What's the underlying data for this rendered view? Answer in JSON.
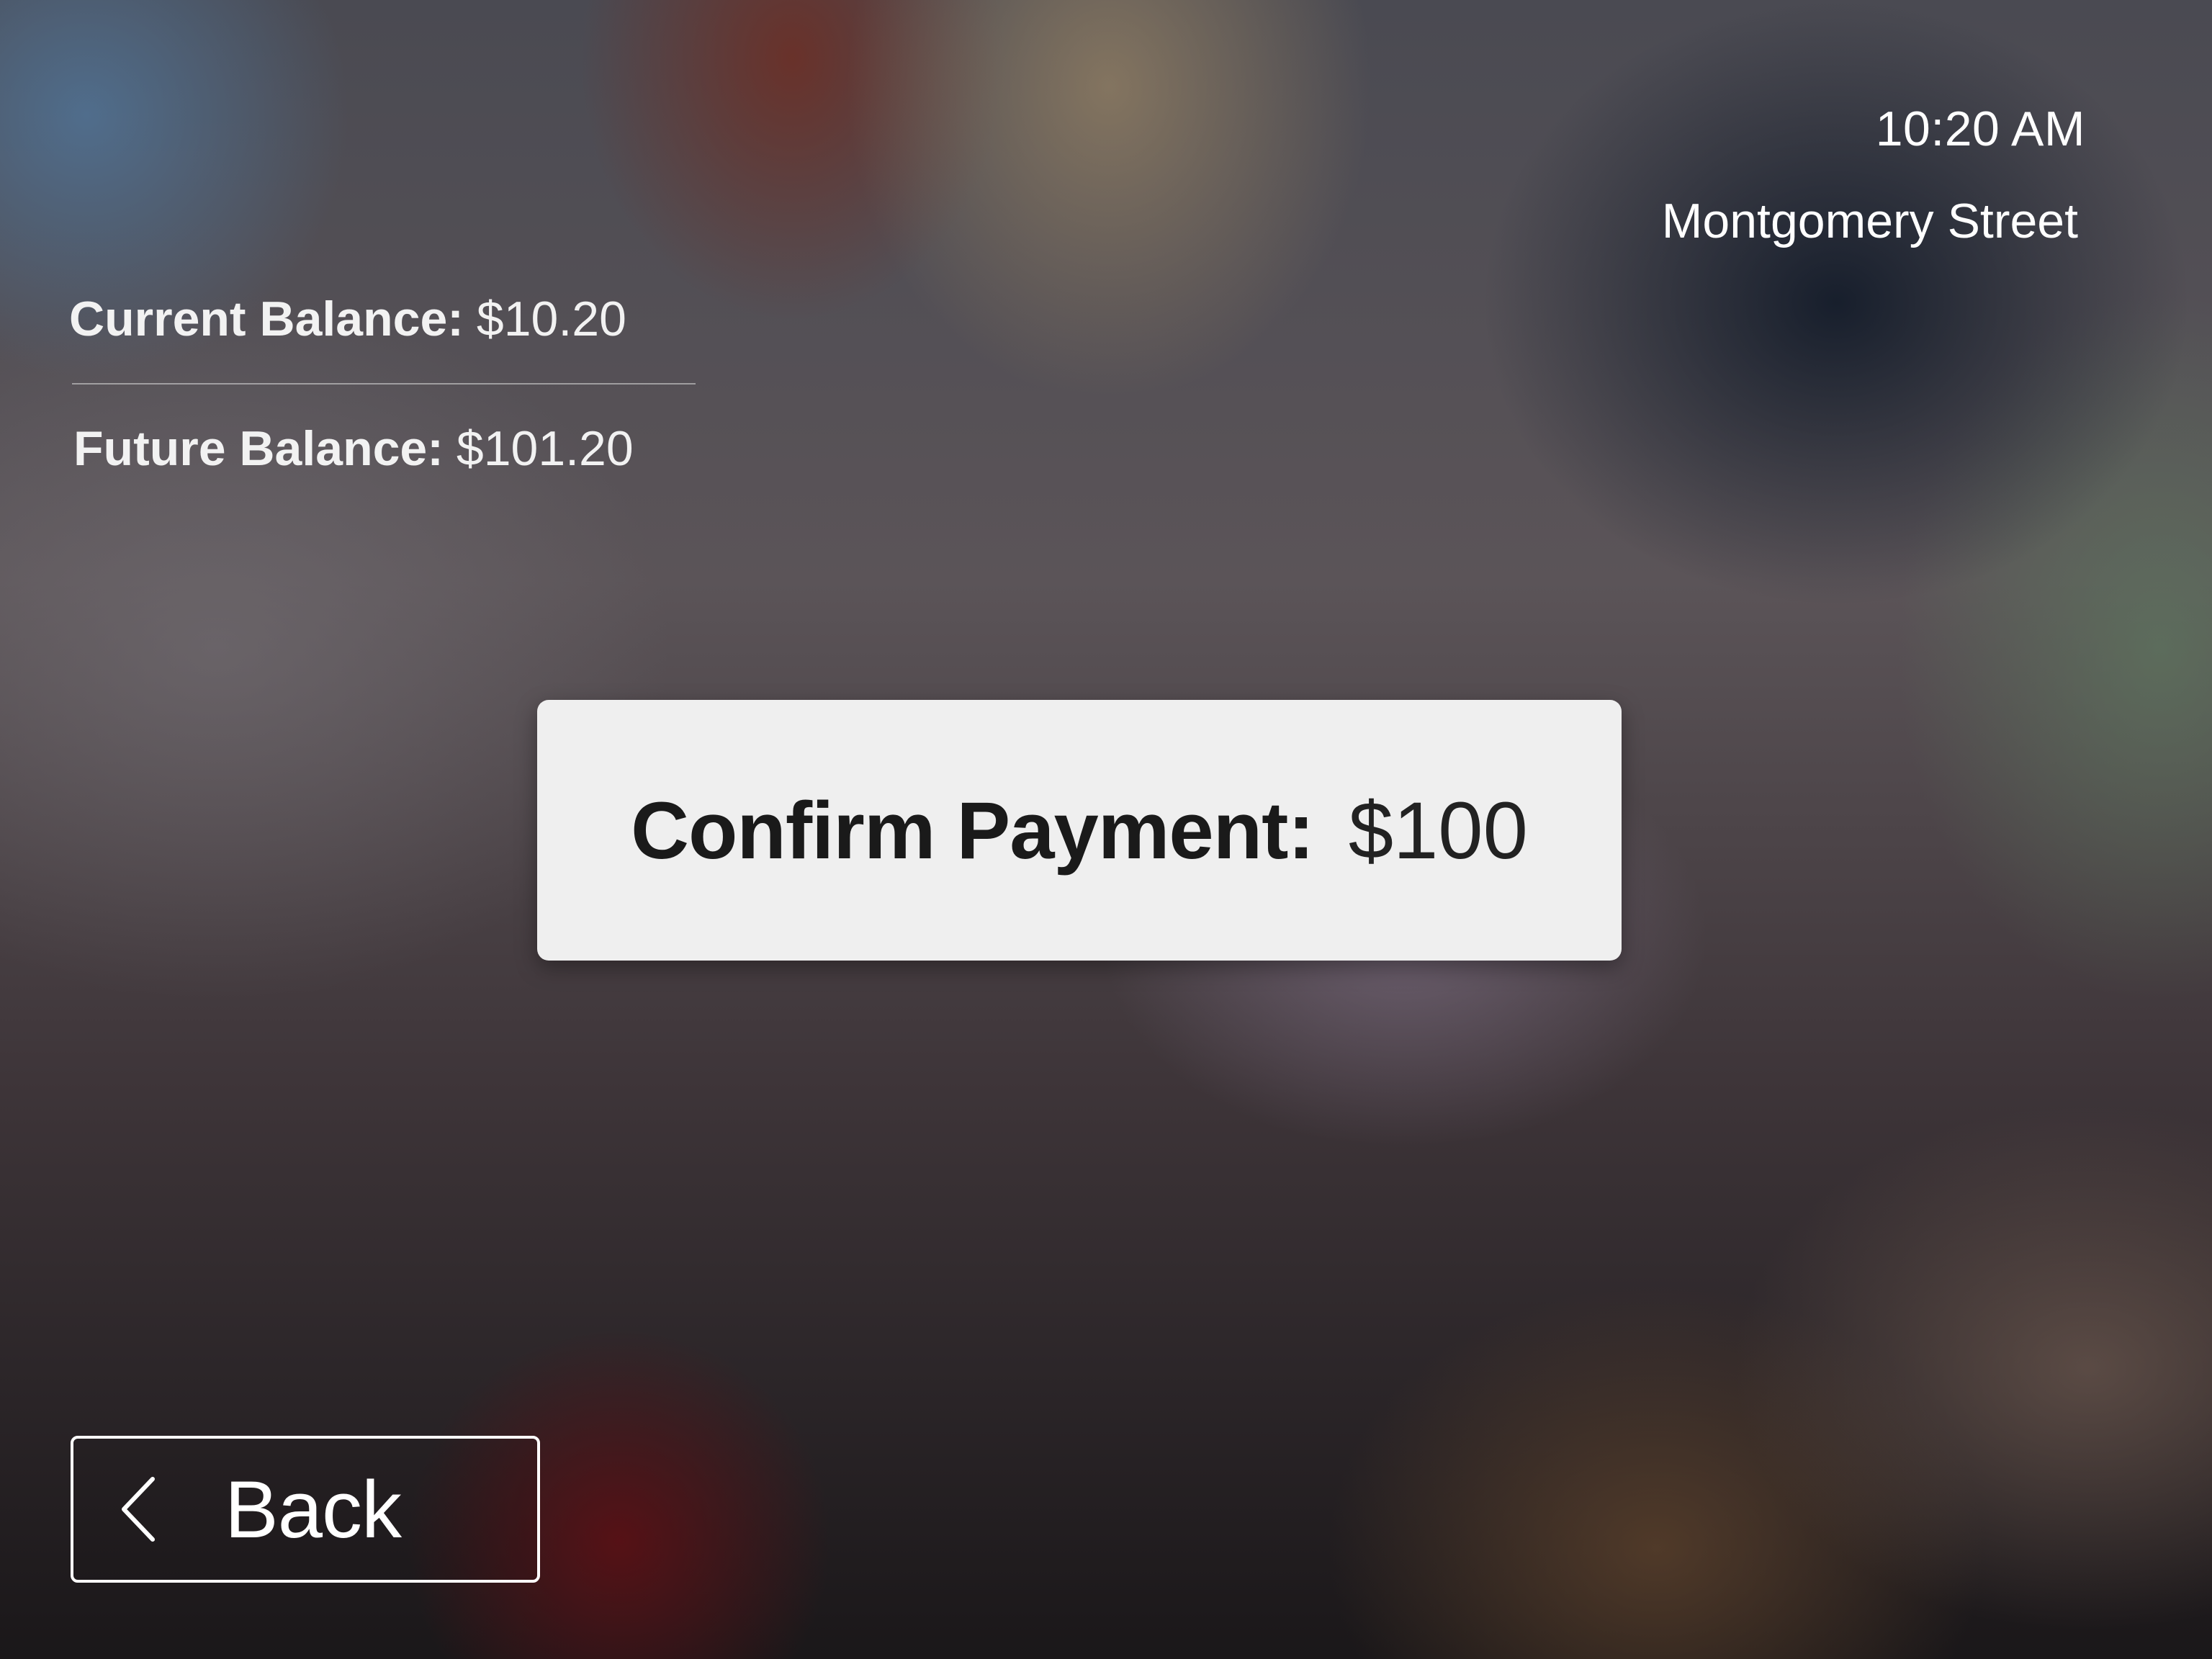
{
  "status": {
    "time": "10:20 AM",
    "station": "Montgomery Street"
  },
  "balances": {
    "current_label": "Current Balance:",
    "current_value": "$10.20",
    "future_label": "Future Balance:",
    "future_value": "$101.20"
  },
  "confirm": {
    "label": "Confirm Payment:",
    "amount": "$100"
  },
  "back": {
    "label": "Back",
    "icon": "chevron-left-icon"
  }
}
